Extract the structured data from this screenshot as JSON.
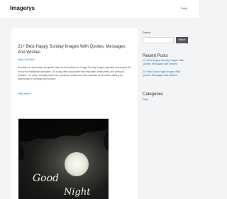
{
  "header": {
    "site_title": "Imagerys",
    "nav_daily": "Daily"
  },
  "post": {
    "title": "21+ Best Happy Sunday Images With Quotes, Messages And Wishes",
    "meta": "Daily / By Shiek",
    "excerpt": "Sunday is a universally recognized day of rest and leisure. Happy Sunday Images typically occurring at the end of the traditional workweek. It's a day often associated with relaxation, family time, and personal pursuits. For many, Sunday serves as a welcome break from the busyness of the week, offering an opportunity to recharge and unwind.",
    "read_more": "Read More »",
    "image_text_line1": "Good",
    "image_text_line2": "Night"
  },
  "sidebar": {
    "search_label": "Search",
    "search_button": "Search",
    "recent_posts_heading": "Recent Posts",
    "recent_posts": [
      "21+ Best Happy Sunday Images With Quotes, Messages And Wishes",
      "21+ Best Good Night Images With Quotes, Messages And Wishes"
    ],
    "categories_heading": "Categories",
    "categories": [
      "Daily"
    ]
  }
}
